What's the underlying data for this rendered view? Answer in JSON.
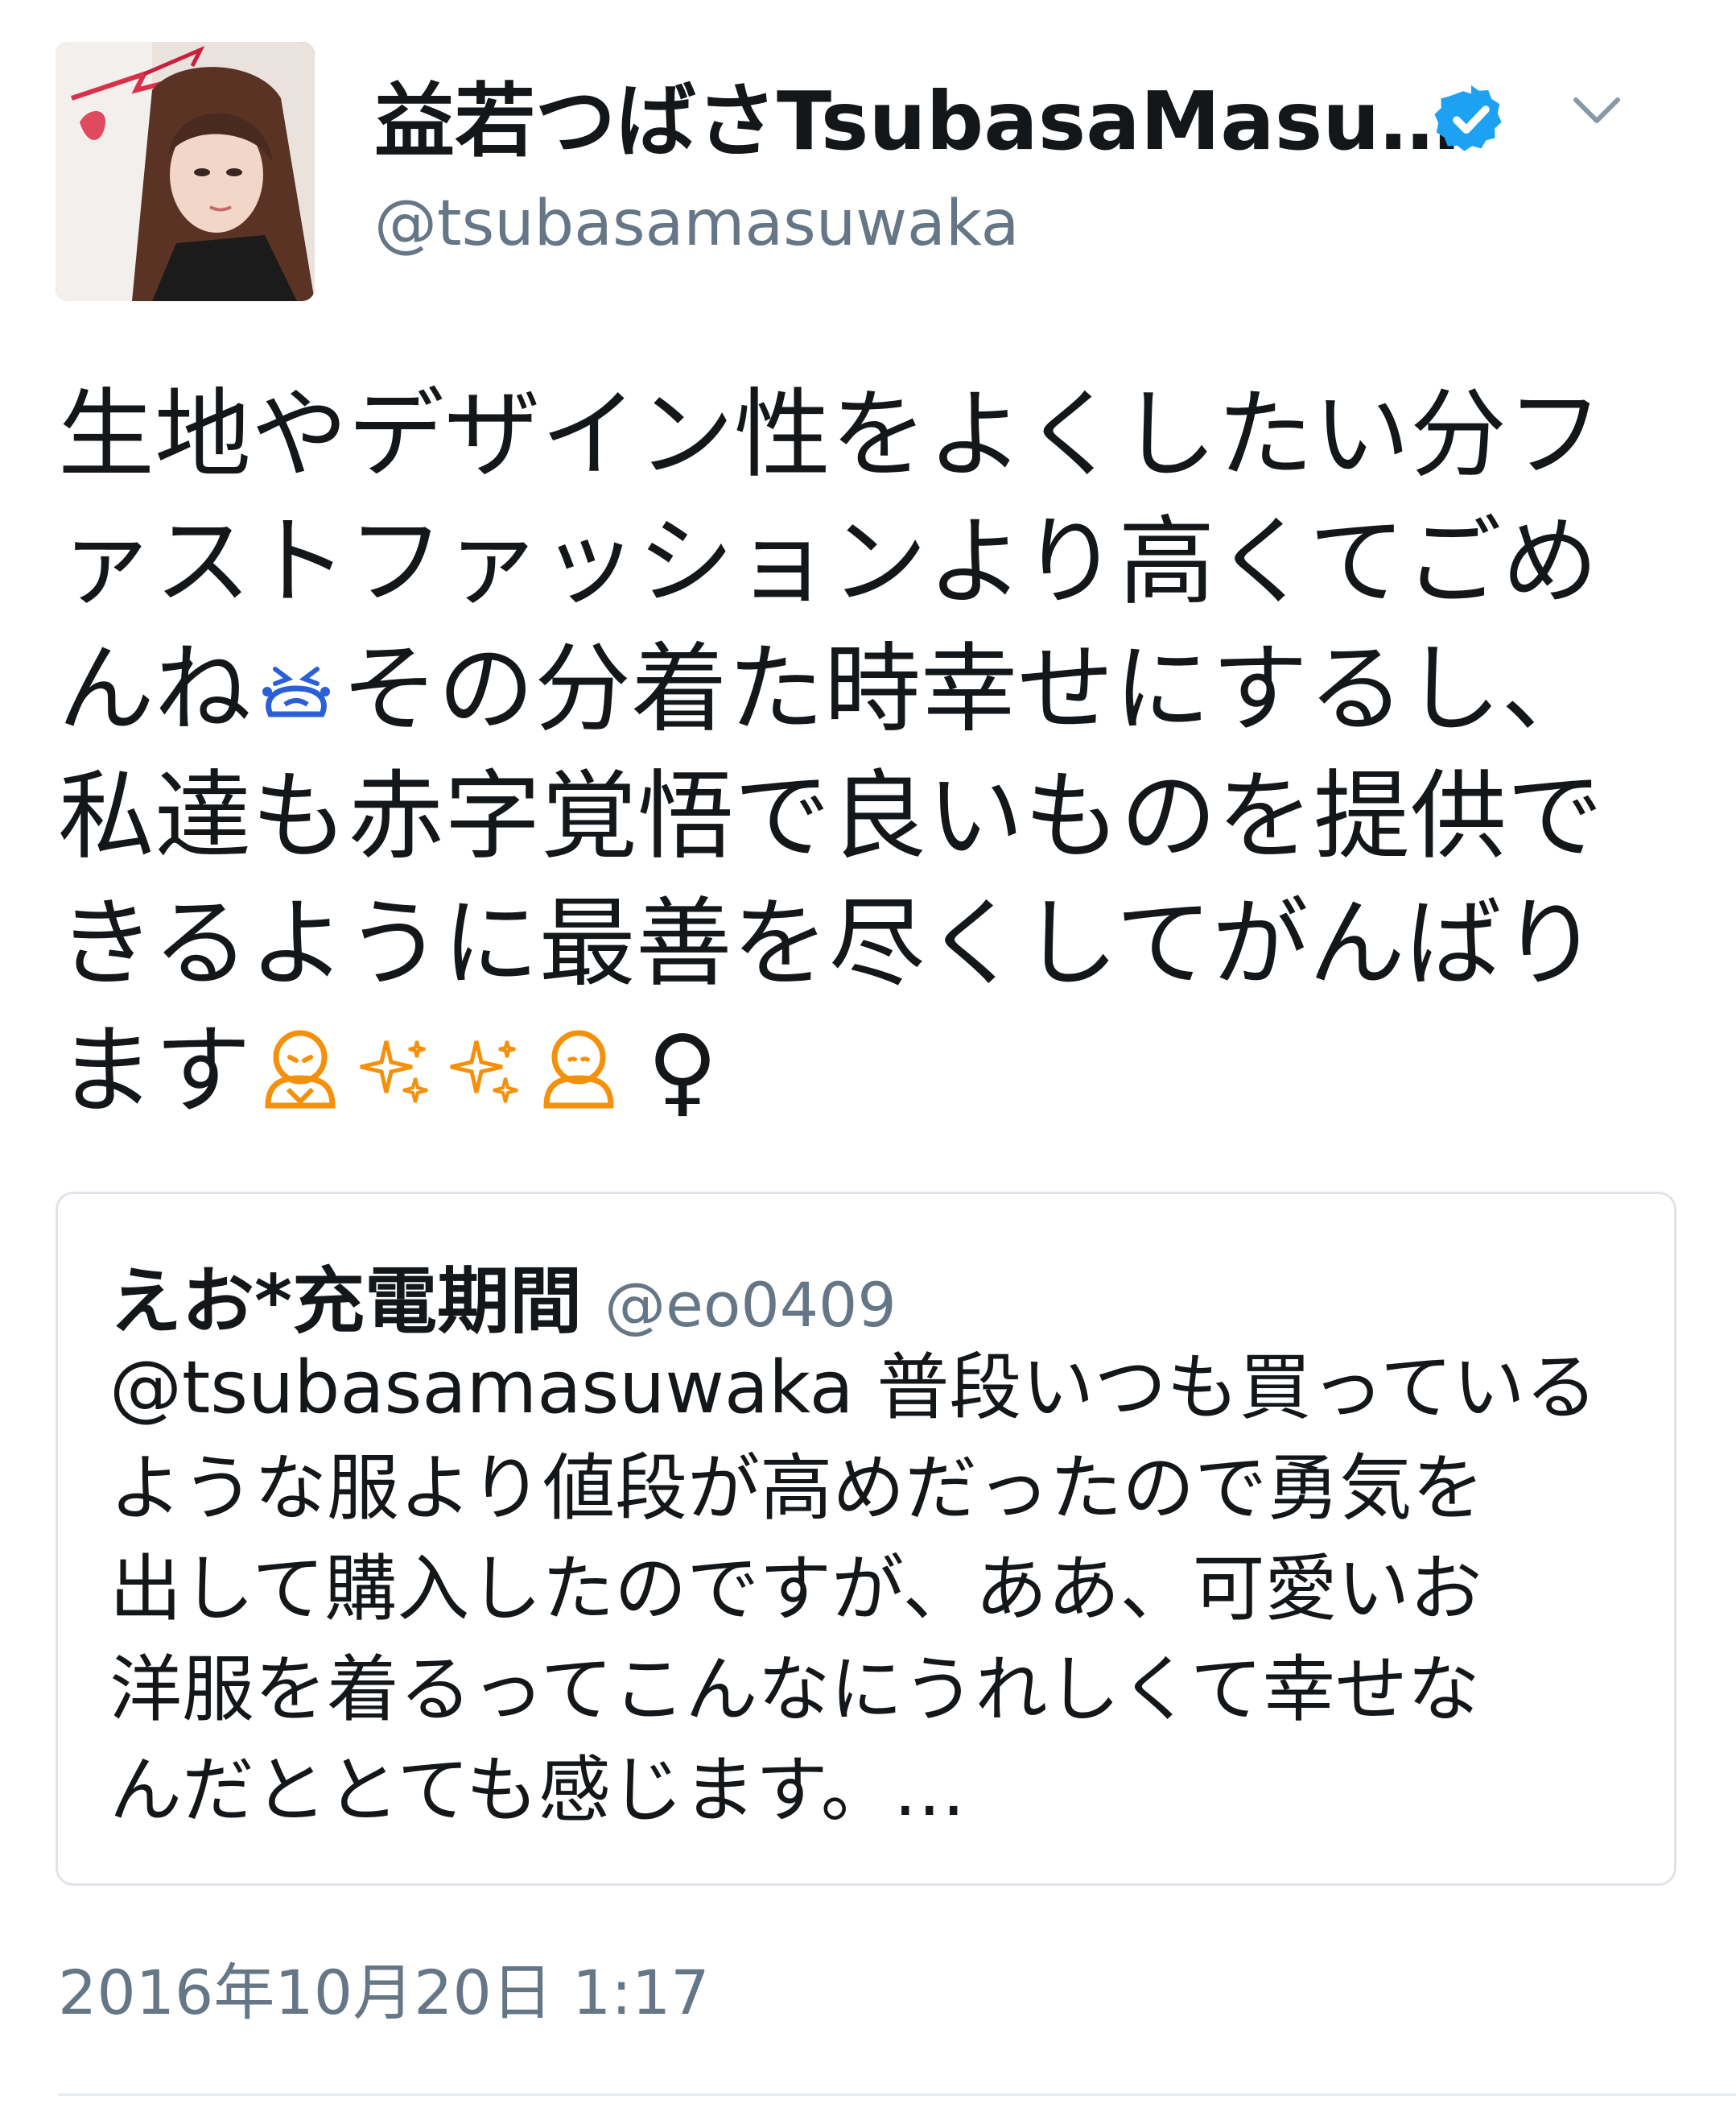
{
  "author": {
    "display_name": "益若つばさTsubasaMasu…",
    "handle": "@tsubasamasuwaka",
    "verified": true
  },
  "icons": {
    "avatar": "profile-photo",
    "verified": "verified-badge-icon",
    "more": "chevron-down-icon"
  },
  "tweet": {
    "lines": [
      "生地やデザイン性をよくしたい分フ",
      "ァストファッションより高くてごめ",
      "んね",
      "その分着た時幸せにするし、",
      "私達も赤字覚悟で良いものを提供で",
      "きるように最善を尽くしてがんばり",
      "ます",
      "♀"
    ]
  },
  "quoted": {
    "name": "えお*充電期間",
    "handle": "@eo0409",
    "mention": "@tsubasamasuwaka",
    "lines": [
      " 普段いつも買っている",
      "ような服より値段が高めだったので勇気を",
      "出して購入したのですが、ああ、可愛いお",
      "洋服を着るってこんなにうれしくて幸せな",
      "んだととても感じます。…"
    ]
  },
  "timestamp": "2016年10月20日 1:17",
  "colors": {
    "text": "#14171a",
    "secondary": "#657786",
    "verified_blue": "#1da1f2",
    "border": "#dfe3e7",
    "emoji_orange": "#f4900c"
  }
}
